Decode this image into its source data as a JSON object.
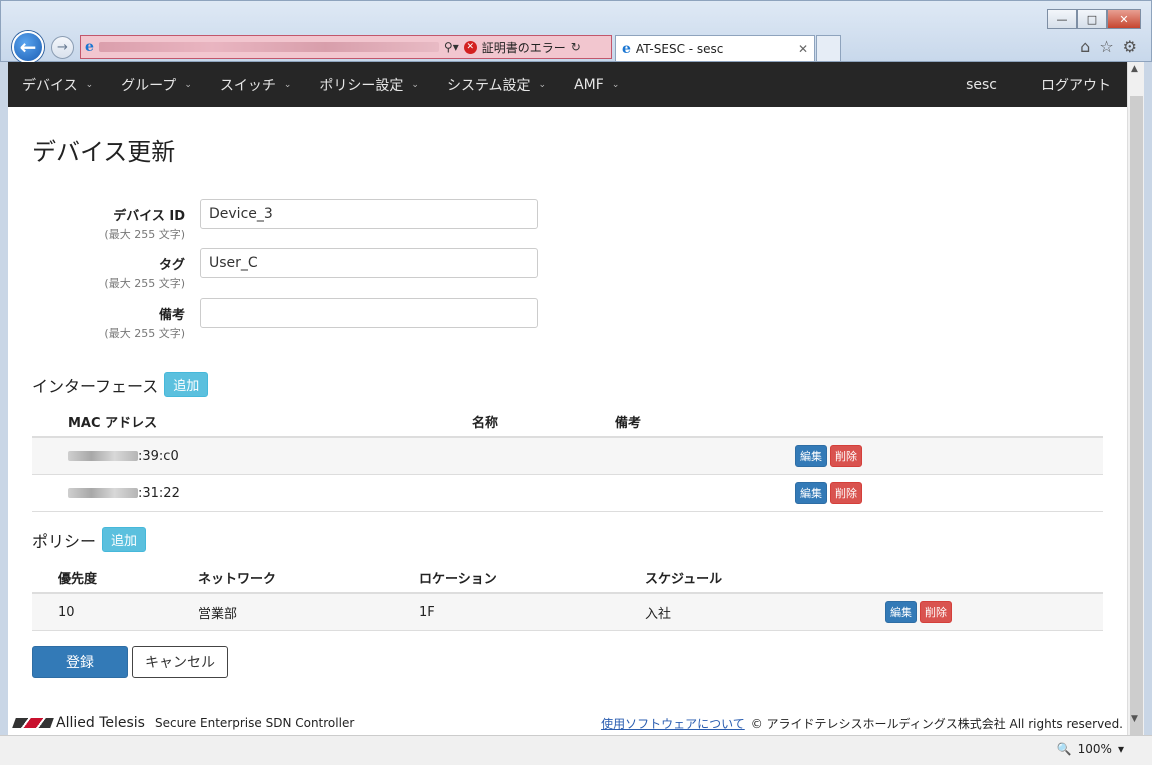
{
  "browser": {
    "cert_error": "証明書のエラー",
    "tab_title": "AT-SESC - sesc",
    "zoom": "100%"
  },
  "navbar": {
    "items": [
      "デバイス",
      "グループ",
      "スイッチ",
      "ポリシー設定",
      "システム設定",
      "AMF"
    ],
    "user": "sesc",
    "logout": "ログアウト"
  },
  "page": {
    "title": "デバイス更新"
  },
  "form": {
    "device_id": {
      "label": "デバイス ID",
      "hint": "(最大 255 文字)",
      "value": "Device_3"
    },
    "tag": {
      "label": "タグ",
      "hint": "(最大 255 文字)",
      "value": "User_C"
    },
    "note": {
      "label": "備考",
      "hint": "(最大 255 文字)",
      "value": ""
    }
  },
  "interfaces": {
    "title": "インターフェース",
    "add": "追加",
    "headers": [
      "MAC アドレス",
      "名称",
      "備考"
    ],
    "rows": [
      {
        "mac_suffix": ":39:c0",
        "name": "",
        "note": ""
      },
      {
        "mac_suffix": ":31:22",
        "name": "",
        "note": ""
      }
    ],
    "edit": "編集",
    "delete": "削除"
  },
  "policies": {
    "title": "ポリシー",
    "add": "追加",
    "headers": [
      "優先度",
      "ネットワーク",
      "ロケーション",
      "スケジュール"
    ],
    "rows": [
      {
        "priority": "10",
        "network": "営業部",
        "location": "1F",
        "schedule": "入社"
      }
    ],
    "edit": "編集",
    "delete": "削除"
  },
  "actions": {
    "submit": "登録",
    "cancel": "キャンセル"
  },
  "footer": {
    "brand": "Allied Telesis",
    "product": "Secure Enterprise SDN Controller",
    "software_link": "使用ソフトウェアについて",
    "copyright": "© アライドテレシスホールディングス株式会社 All rights reserved."
  }
}
